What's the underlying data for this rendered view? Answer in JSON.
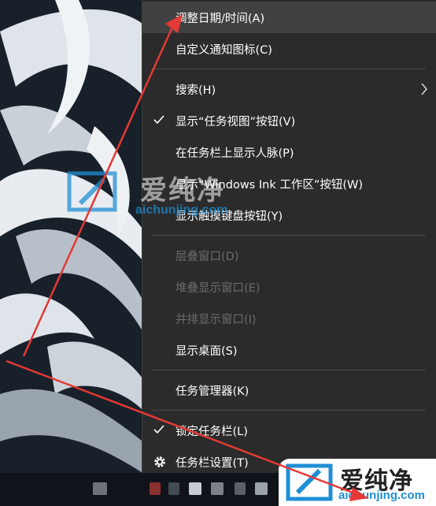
{
  "context_menu": {
    "items": [
      {
        "label": "调整日期/时间(A)"
      },
      {
        "label": "自定义通知图标(C)"
      },
      {
        "label": "搜索(H)"
      },
      {
        "label": "显示“任务视图”按钮(V)"
      },
      {
        "label": "在任务栏上显示人脉(P)"
      },
      {
        "label": "显示“Windows Ink 工作区”按钮(W)"
      },
      {
        "label": "显示触摸键盘按钮(Y)"
      },
      {
        "label": "层叠窗口(D)"
      },
      {
        "label": "堆叠显示窗口(E)"
      },
      {
        "label": "并排显示窗口(I)"
      },
      {
        "label": "显示桌面(S)"
      },
      {
        "label": "任务管理器(K)"
      },
      {
        "label": "锁定任务栏(L)"
      },
      {
        "label": "任务栏设置(T)"
      }
    ]
  },
  "watermark": {
    "brand": "爱纯净",
    "url": "aichunjing.com"
  },
  "colors": {
    "menu_bg": "#2b2b2b",
    "menu_hover": "#414141",
    "disabled_text": "#6b6b6b",
    "annotation": "#e53935",
    "watermark_blue": "#1f8fd6"
  },
  "icons": {
    "check": "check-icon",
    "submenu": "chevron-right-icon",
    "settings": "gear-icon"
  }
}
